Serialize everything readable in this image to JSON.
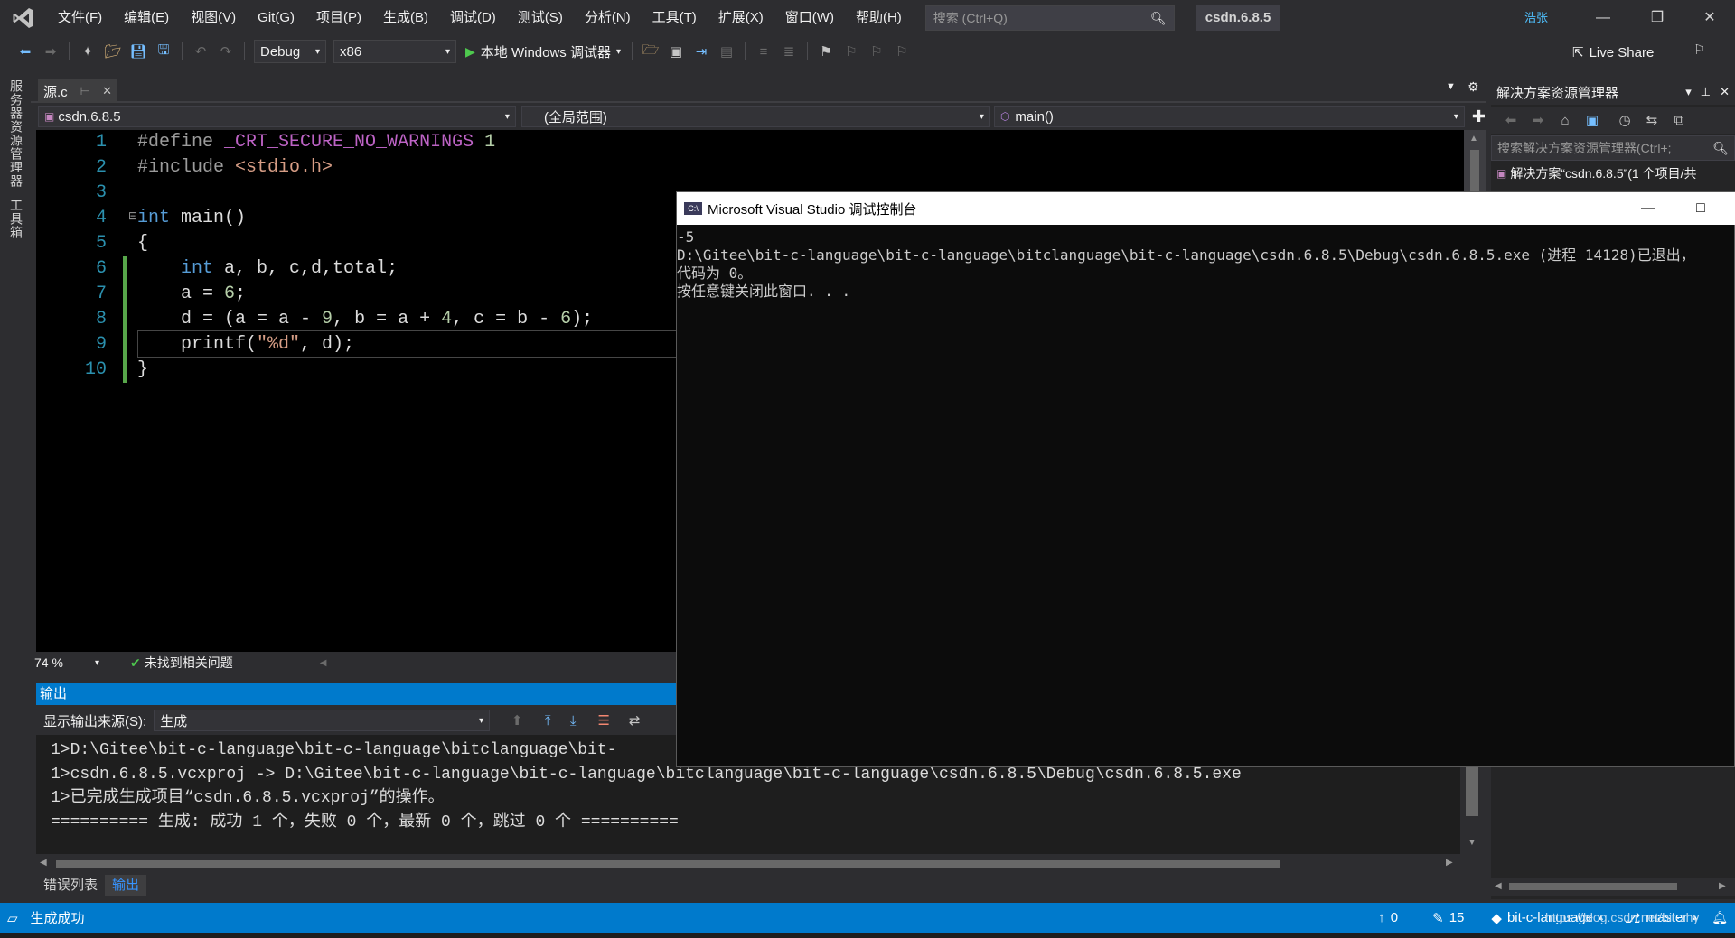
{
  "app": {
    "solution_name": "csdn.6.8.5",
    "user_initials": "浩张",
    "accent_color": "#007acc"
  },
  "menu": [
    "文件(F)",
    "编辑(E)",
    "视图(V)",
    "Git(G)",
    "项目(P)",
    "生成(B)",
    "调试(D)",
    "测试(S)",
    "分析(N)",
    "工具(T)",
    "扩展(X)",
    "窗口(W)",
    "帮助(H)"
  ],
  "search": {
    "placeholder": "搜索 (Ctrl+Q)"
  },
  "toolbar": {
    "config": "Debug",
    "platform": "x86",
    "run_label": "本地 Windows 调试器",
    "live_share": "Live Share"
  },
  "left_strip": {
    "server_explorer": "服务器资源管理器",
    "toolbox": "工具箱"
  },
  "editor": {
    "tab_label": "源.c",
    "nav_project": "csdn.6.8.5",
    "nav_scope": "(全局范围)",
    "nav_function": "main()",
    "line_numbers": [
      "1",
      "2",
      "3",
      "4",
      "5",
      "6",
      "7",
      "8",
      "9",
      "10"
    ],
    "zoom": "74 %",
    "issues": "未找到相关问题"
  },
  "output": {
    "title": "输出",
    "source_label": "显示输出来源(S):",
    "source_value": "生成",
    "lines": [
      "1>D:\\Gitee\\bit-c-language\\bit-c-language\\bitclanguage\\bit-",
      "1>csdn.6.8.5.vcxproj -> D:\\Gitee\\bit-c-language\\bit-c-language\\bitclanguage\\bit-c-language\\csdn.6.8.5\\Debug\\csdn.6.8.5.exe",
      "1>已完成生成项目“csdn.6.8.5.vcxproj”的操作。",
      "========== 生成: 成功 1 个，失败 0 个，最新 0 个，跳过 0 个 =========="
    ],
    "tabs": [
      "错误列表",
      "输出"
    ]
  },
  "solution_explorer": {
    "title": "解决方案资源管理器",
    "search_placeholder": "搜索解决方案资源管理器(Ctrl+;",
    "root_label": "解决方案“csdn.6.8.5”(1 个项目/共"
  },
  "console": {
    "title": "Microsoft Visual Studio 调试控制台",
    "icon_text": "C:\\",
    "lines": [
      "-5",
      "D:\\Gitee\\bit-c-language\\bit-c-language\\bitclanguage\\bit-c-language\\csdn.6.8.5\\Debug\\csdn.6.8.5.exe (进程 14128)已退出，",
      "代码为 0。",
      "按任意键关闭此窗口. . ."
    ]
  },
  "statusbar": {
    "message": "生成成功",
    "up_count": "0",
    "edit_count": "15",
    "repo": "bit-c-language",
    "branch": "master",
    "watermark": "https://blog.csdn.net/bit-zhy"
  }
}
